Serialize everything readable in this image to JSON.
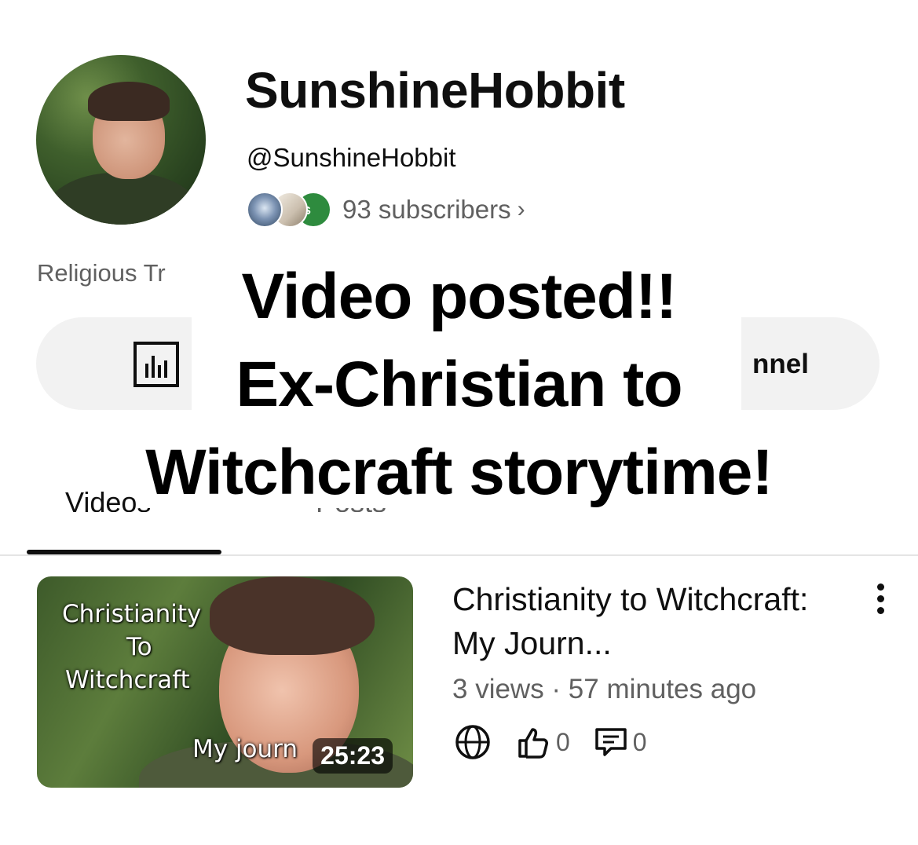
{
  "channel": {
    "name": "SunshineHobbit",
    "handle": "@SunshineHobbit",
    "subscribers": "93 subscribers",
    "subscriber_avatar_letter": "s",
    "description_fragment": "Religious Tr",
    "manage_button_fragment": "nnel"
  },
  "overlay_caption": {
    "line1": "Video posted!!",
    "line2": "Ex-Christian to",
    "line3": "Witchcraft storytime!"
  },
  "tabs": [
    {
      "label": "Videos",
      "selected": true
    },
    {
      "label": "Posts",
      "selected": false
    }
  ],
  "video": {
    "thumbnail_text": [
      "Christianity",
      "To",
      "Witchcraft",
      "My journ"
    ],
    "duration": "25:23",
    "title": "Christianity to Witchcraft: My Journ...",
    "meta": "3 views · 57 minutes ago",
    "visibility_icon": "globe-icon",
    "likes": "0",
    "comments": "0"
  },
  "colors": {
    "text_primary": "#0f0f0f",
    "text_secondary": "#606060",
    "chip_background": "#f2f2f2",
    "subscriber_badge_green": "#2e8b3e"
  }
}
